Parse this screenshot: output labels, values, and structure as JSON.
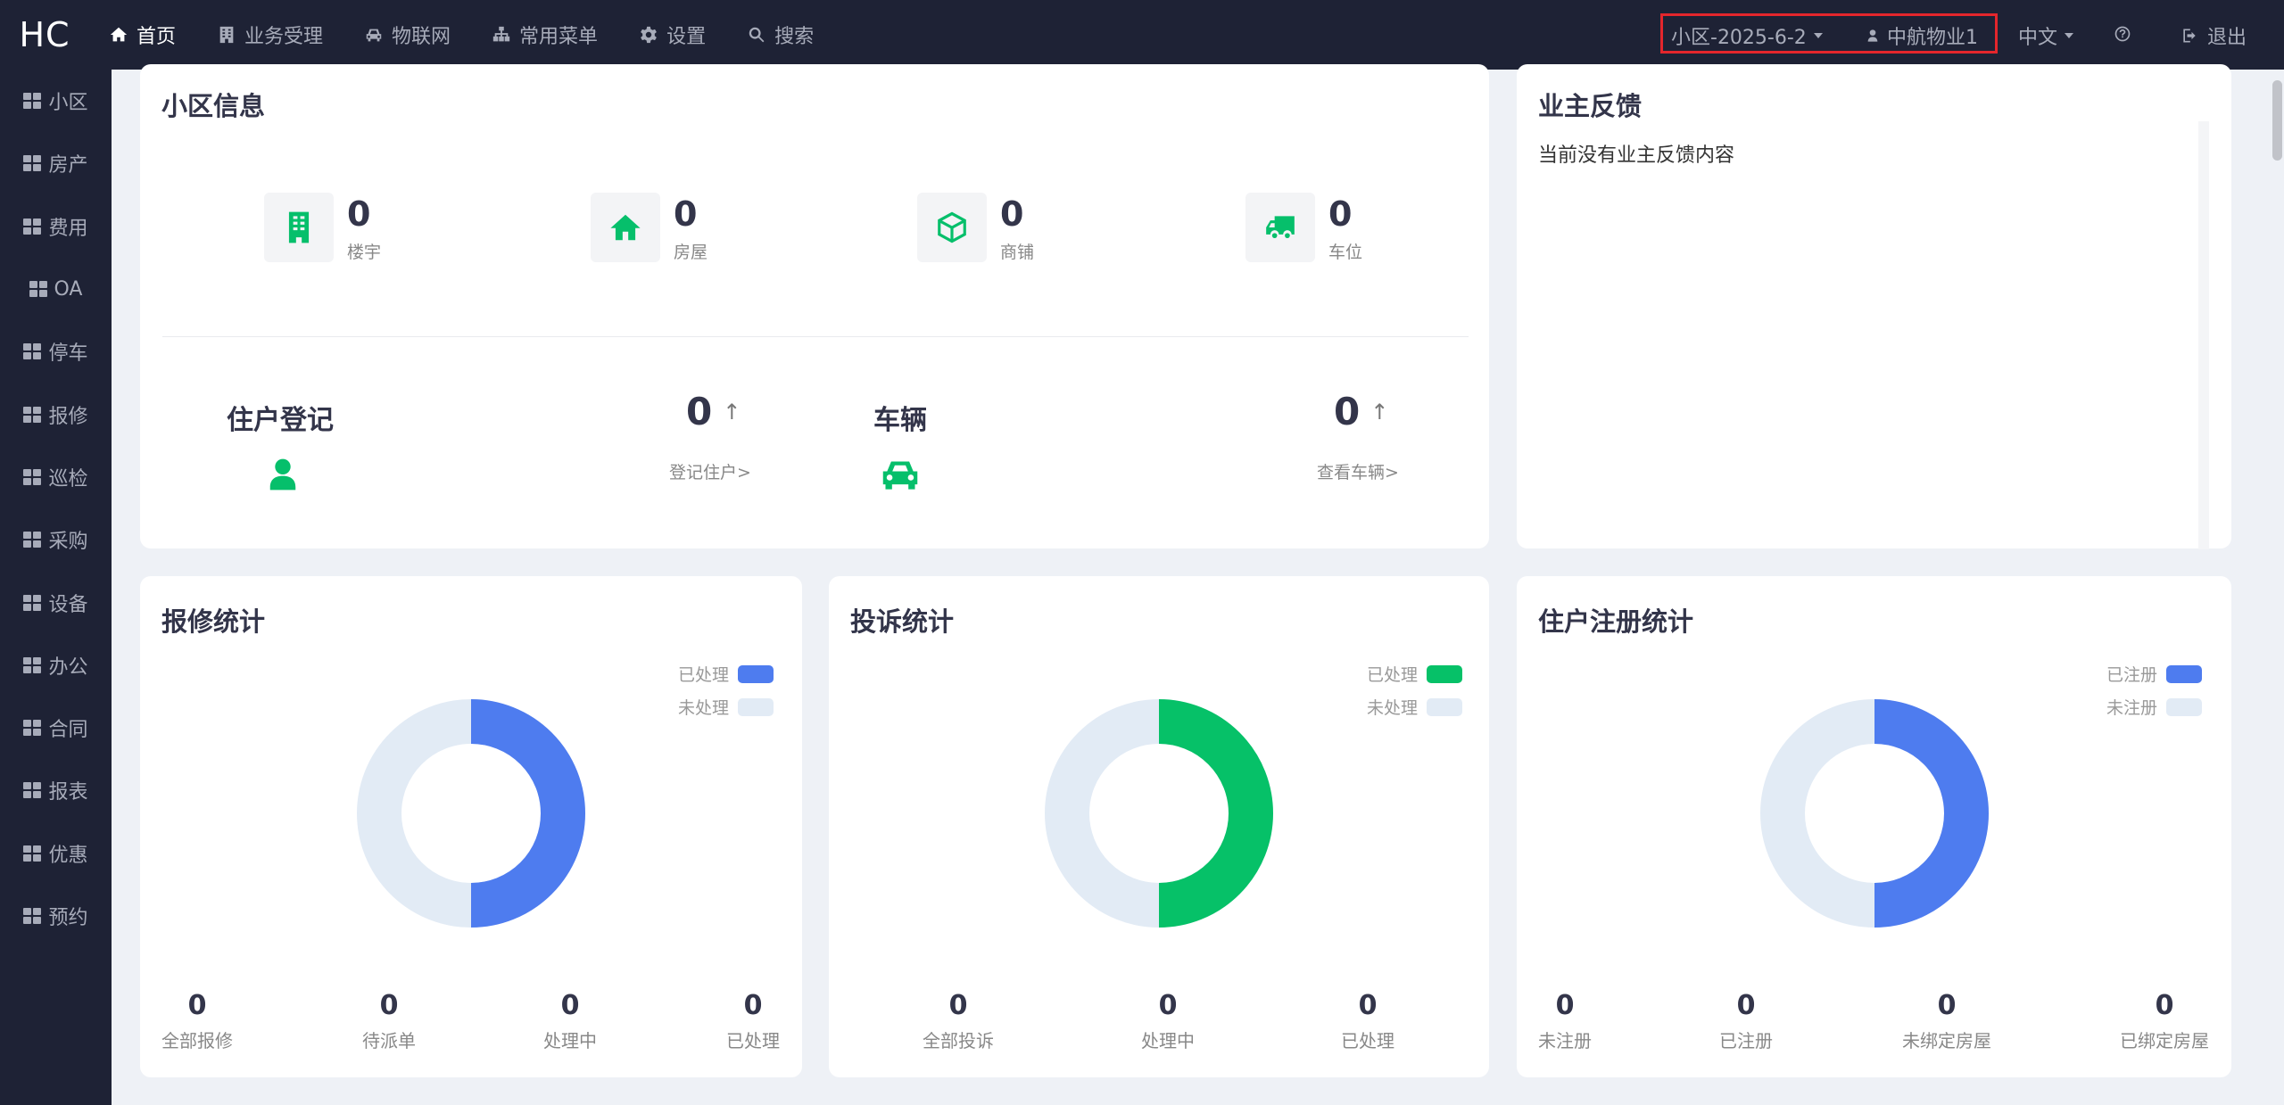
{
  "app": {
    "logo": "HC"
  },
  "topnav": [
    {
      "label": "首页",
      "icon": "home-icon",
      "active": true
    },
    {
      "label": "业务受理",
      "icon": "building-icon"
    },
    {
      "label": "物联网",
      "icon": "car-icon"
    },
    {
      "label": "常用菜单",
      "icon": "sitemap-icon"
    },
    {
      "label": "设置",
      "icon": "gear-icon"
    },
    {
      "label": "搜索",
      "icon": "search-icon"
    }
  ],
  "header_right": {
    "community": "小区-2025-6-2",
    "user": "中航物业1",
    "language": "中文",
    "help_icon": "question-circle-icon",
    "logout": "退出"
  },
  "sidebar": [
    {
      "label": "小区"
    },
    {
      "label": "房产"
    },
    {
      "label": "费用"
    },
    {
      "label": "OA"
    },
    {
      "label": "停车"
    },
    {
      "label": "报修"
    },
    {
      "label": "巡检"
    },
    {
      "label": "采购"
    },
    {
      "label": "设备"
    },
    {
      "label": "办公"
    },
    {
      "label": "合同"
    },
    {
      "label": "报表"
    },
    {
      "label": "优惠"
    },
    {
      "label": "预约"
    }
  ],
  "community_info": {
    "title": "小区信息",
    "stats": [
      {
        "num": "0",
        "label": "楼宇",
        "icon": "building-icon"
      },
      {
        "num": "0",
        "label": "房屋",
        "icon": "home-icon"
      },
      {
        "num": "0",
        "label": "商铺",
        "icon": "cube-icon"
      },
      {
        "num": "0",
        "label": "车位",
        "icon": "truck-icon"
      }
    ],
    "resident": {
      "title": "住户登记",
      "num": "0",
      "arrow": "↑",
      "link": "登记住户>"
    },
    "vehicle": {
      "title": "车辆",
      "num": "0",
      "arrow": "↑",
      "link": "查看车辆>"
    }
  },
  "feedback": {
    "title": "业主反馈",
    "empty": "当前没有业主反馈内容"
  },
  "repair": {
    "title": "报修统计",
    "legend": [
      "已处理",
      "未处理"
    ],
    "stats": [
      {
        "num": "0",
        "label": "全部报修"
      },
      {
        "num": "0",
        "label": "待派单"
      },
      {
        "num": "0",
        "label": "处理中"
      },
      {
        "num": "0",
        "label": "已处理"
      }
    ]
  },
  "complaint": {
    "title": "投诉统计",
    "legend": [
      "已处理",
      "未处理"
    ],
    "stats": [
      {
        "num": "0",
        "label": "全部投诉"
      },
      {
        "num": "0",
        "label": "处理中"
      },
      {
        "num": "0",
        "label": "已处理"
      }
    ]
  },
  "register": {
    "title": "住户注册统计",
    "legend": [
      "已注册",
      "未注册"
    ],
    "stats": [
      {
        "num": "0",
        "label": "未注册"
      },
      {
        "num": "0",
        "label": "已注册"
      },
      {
        "num": "0",
        "label": "未绑定房屋"
      },
      {
        "num": "0",
        "label": "已绑定房屋"
      }
    ]
  },
  "colors": {
    "blue": "#4e7cef",
    "green": "#06c168",
    "light": "#e2ebf5",
    "nav_bg": "#1e2235",
    "highlight": "#e4262c"
  }
}
